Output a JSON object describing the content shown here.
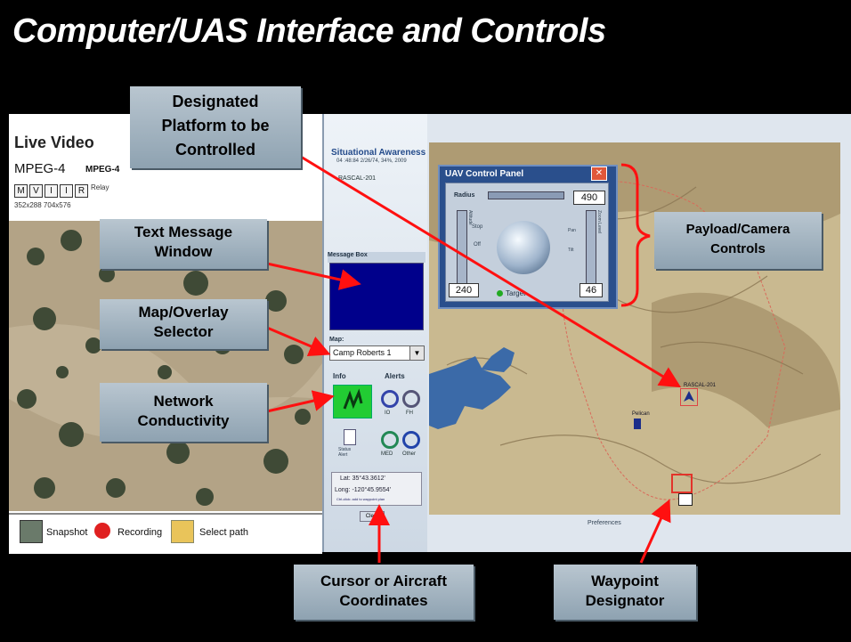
{
  "slide_title": "Computer/UAS Interface and Controls",
  "video_panel": {
    "title": "Live Video",
    "codec_main": "MPEG-4",
    "codec_sub": "MPEG-4",
    "keys": [
      "M",
      "V",
      "I",
      "I",
      "R"
    ],
    "relay_label": "Relay",
    "resolution": "352x288  704x576",
    "toolbar": {
      "snapshot": "Snapshot",
      "recording": "Recording",
      "select_path": "Select path"
    }
  },
  "situational_awareness": {
    "title": "Situational Awareness",
    "subtitle": "04 :48:84   2/26/74, 34%, 2009",
    "platform": "RASCAL-201"
  },
  "message_box": {
    "title": "Message Box"
  },
  "map_selector": {
    "label": "Map:",
    "value": "Camp Roberts 1",
    "arrow": "▼"
  },
  "status_tabs": {
    "info": "Info",
    "alerts": "Alerts"
  },
  "alerts": [
    "IO",
    "FH",
    "MED",
    "Other"
  ],
  "status_icon_label": "Status\nAlert",
  "coordinates": {
    "lat": "Lat:   35°43.3612'",
    "long": "Long:  -120°45.9554'",
    "hint": "Ctrl-click: add to waypoint plan",
    "clear_button": "Clear"
  },
  "uav_panel": {
    "title": "UAV Control Panel",
    "close_symbol": "✕",
    "radius_label": "Radius",
    "radius_value": "490",
    "altitude_value": "240",
    "zoom_value": "46",
    "stop_label": "Stop",
    "off_label": "Off",
    "pan_label": "Pan",
    "tilt_label": "Tilt",
    "target_label": "Target",
    "left_slider_label": "Altitude",
    "right_slider_label": "Zoom Level"
  },
  "map_labels": {
    "aircraft": "RASCAL-201",
    "other_platform": "Pelican",
    "preferences": "Preferences"
  },
  "callouts": {
    "platform": [
      "Designated",
      "Platform to be",
      "Controlled"
    ],
    "text_message": [
      "Text Message",
      "Window"
    ],
    "map_overlay": [
      "Map/Overlay",
      "Selector"
    ],
    "network": [
      "Network",
      "Conductivity"
    ],
    "payload": [
      "Payload/Camera",
      "Controls"
    ],
    "cursor": [
      "Cursor or Aircraft",
      "Coordinates"
    ],
    "waypoint": [
      "Waypoint",
      "Designator"
    ]
  },
  "colors": {
    "arrow": "#ff1010",
    "callout_top": "#b9c6d0",
    "callout_bottom": "#8ea2b1",
    "message_box": "#00008b",
    "network_ok": "#22cc33",
    "uav_panel": "#2a4f8c"
  }
}
